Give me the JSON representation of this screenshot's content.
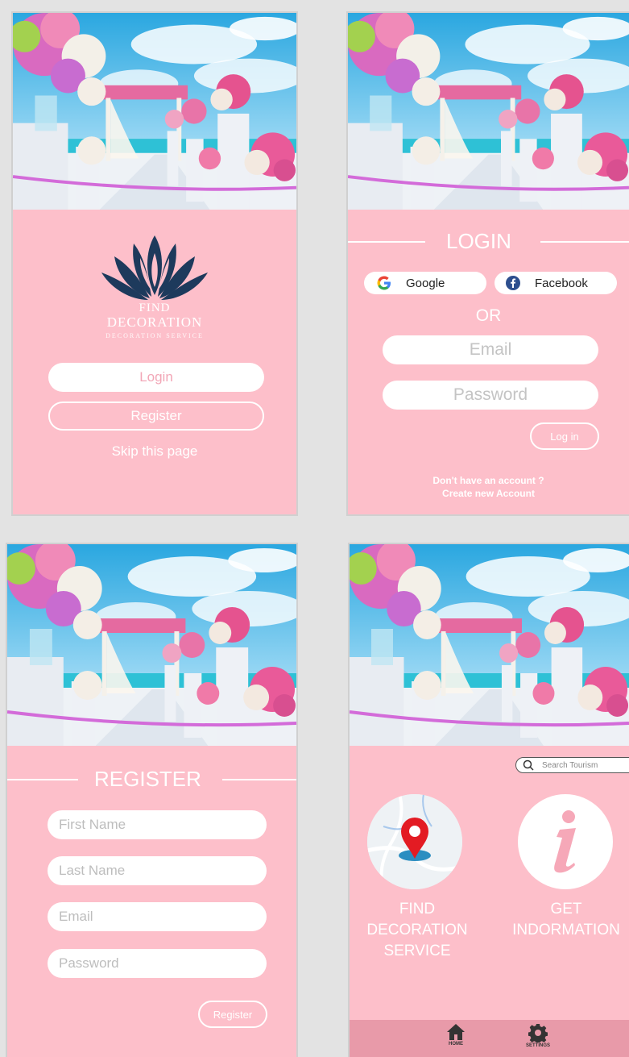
{
  "colors": {
    "screen_bg": "#fdbfca",
    "navy": "#1d3a5c",
    "white": "#ffffff",
    "nav_bg": "#e89aa9"
  },
  "welcome": {
    "brand_line1": "FIND",
    "brand_line2": "DECORATION",
    "brand_line3": "DECORATION SERVICE",
    "login_label": "Login",
    "register_label": "Register",
    "skip_label": "Skip this page"
  },
  "login": {
    "title": "LOGIN",
    "google_label": "Google",
    "facebook_label": "Facebook",
    "or_label": "OR",
    "email_placeholder": "Email",
    "password_placeholder": "Password",
    "login_button": "Log in",
    "no_account": "Don't have an account ?",
    "create_account": "Create new Account"
  },
  "register": {
    "title": "REGISTER",
    "first_name": "First Name",
    "last_name": "Last Name",
    "email": "Email",
    "password": "Password",
    "register_button": "Register"
  },
  "home": {
    "search_placeholder": "Search Tourism",
    "tile1_line1": "FIND",
    "tile1_line2": "DECORATION",
    "tile1_line3": "SERVICE",
    "tile2_line1": "GET",
    "tile2_line2": "INDORMATION",
    "nav_home": "HOME",
    "nav_settings": "SETTINGS"
  }
}
